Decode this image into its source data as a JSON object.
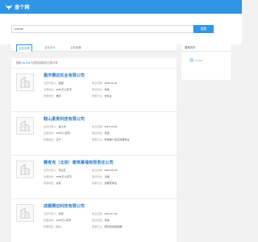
{
  "header": {
    "logo_text": "查个网",
    "brand_color": "#2f95e4"
  },
  "search": {
    "value": "suzhai",
    "button_label": "搜索"
  },
  "tabs": [
    {
      "label": "企业名称",
      "active": true
    },
    {
      "label": "企业法人",
      "active": false
    },
    {
      "label": "企业经营",
      "active": false
    }
  ],
  "summary": {
    "prefix": "搜索",
    "keyword": "\"suzhai\"",
    "middle": "为您找到相关记录",
    "count": "12",
    "suffix": "条"
  },
  "results": [
    {
      "name": "重庆赛迈实业有限公司",
      "legal_label": "法定代表人：",
      "legal": "蔡盛",
      "founded_label": "成立日期：",
      "founded": "2009-11-06",
      "capital_label": "注册资本：",
      "capital": "2000万人民币",
      "status_label": "登记状态：",
      "status": "存续",
      "region_label": "所属地区：",
      "region": "重庆",
      "industry_label": "所属行业：",
      "industry": "零售业"
    },
    {
      "name": "鞍山素麦科技有限公司",
      "legal_label": "法定代表人：",
      "legal": "蓝小丰",
      "founded_label": "成立日期：",
      "founded": "2015-12-26",
      "capital_label": "注册资本：",
      "capital": "200万人民币",
      "status_label": "登记状态：",
      "status": "存续",
      "region_label": "所属地区：",
      "region": "辽宁",
      "industry_label": "所属行业：",
      "industry": "科技推广和应用服务业"
    },
    {
      "name": "赛麦克（北京）建筑幕墙有限责任公司",
      "legal_label": "法定代表人：",
      "legal": "何立红",
      "founded_label": "成立日期：",
      "founded": "2015-05-29",
      "capital_label": "注册资本：",
      "capital": "2000万人民币",
      "status_label": "登记状态：",
      "status": "注销",
      "region_label": "所属地区：",
      "region": "北京",
      "industry_label": "所属行业：",
      "industry": "建筑装饰业"
    },
    {
      "name": "成都赛迈科技有限公司",
      "legal_label": "法定代表人：",
      "legal": "朱雷",
      "founded_label": "成立日期：",
      "founded": "2015-07-03",
      "capital_label": "注册资本：",
      "capital": "1100万人民币",
      "status_label": "登记状态：",
      "status": "存续",
      "region_label": "所属地区：",
      "region": "四川",
      "industry_label": "所属行业：",
      "industry": "研究和试验发展"
    }
  ],
  "sidebar": {
    "title": "搜索历史",
    "history_item": "suzhai"
  },
  "icons": {
    "logo": "deer-head-icon",
    "thumb": "building-icon",
    "history": "clock-icon"
  }
}
